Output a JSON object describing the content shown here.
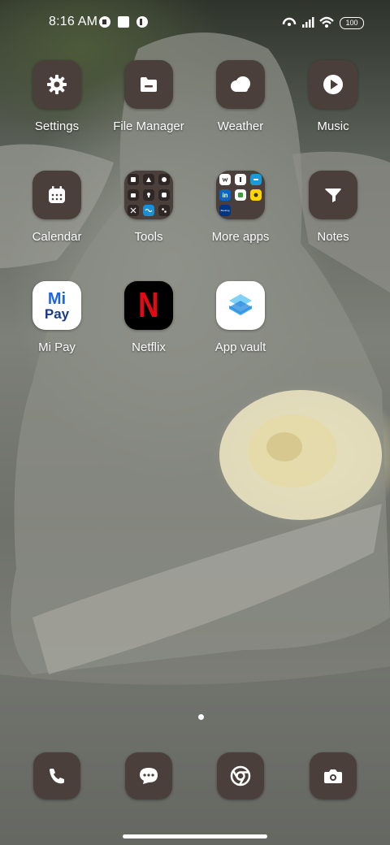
{
  "status_bar": {
    "time": "8:16 AM",
    "battery": "100",
    "icons": [
      "camera-off-icon",
      "notification-square-icon",
      "app-notification-icon",
      "hotspot-icon",
      "signal-icon",
      "wifi-icon",
      "battery-icon"
    ]
  },
  "apps": [
    {
      "label": "Settings",
      "icon": "gear-icon"
    },
    {
      "label": "File Manager",
      "icon": "folder-icon"
    },
    {
      "label": "Weather",
      "icon": "cloud-icon"
    },
    {
      "label": "Music",
      "icon": "play-icon"
    },
    {
      "label": "Calendar",
      "icon": "calendar-icon"
    },
    {
      "label": "Tools",
      "icon": "folder-icon"
    },
    {
      "label": "More apps",
      "icon": "folder-icon"
    },
    {
      "label": "Notes",
      "icon": "notes-icon"
    },
    {
      "label": "Mi Pay",
      "icon": "mi-pay-icon"
    },
    {
      "label": "Netflix",
      "icon": "netflix-icon"
    },
    {
      "label": "App vault",
      "icon": "app-vault-icon"
    }
  ],
  "mi_pay_text": {
    "top": "Mi",
    "bottom": "Pay"
  },
  "netflix_letter": "N",
  "folder_mini_text": {
    "linkedin": "in",
    "booking": "Booking"
  },
  "dock": [
    {
      "icon": "phone-icon"
    },
    {
      "icon": "messages-icon"
    },
    {
      "icon": "chrome-icon"
    },
    {
      "icon": "camera-icon"
    }
  ],
  "colors": {
    "tile": "#4a3f3b",
    "netflix_red": "#e50914",
    "mipay_blue": "#1e64dc"
  }
}
